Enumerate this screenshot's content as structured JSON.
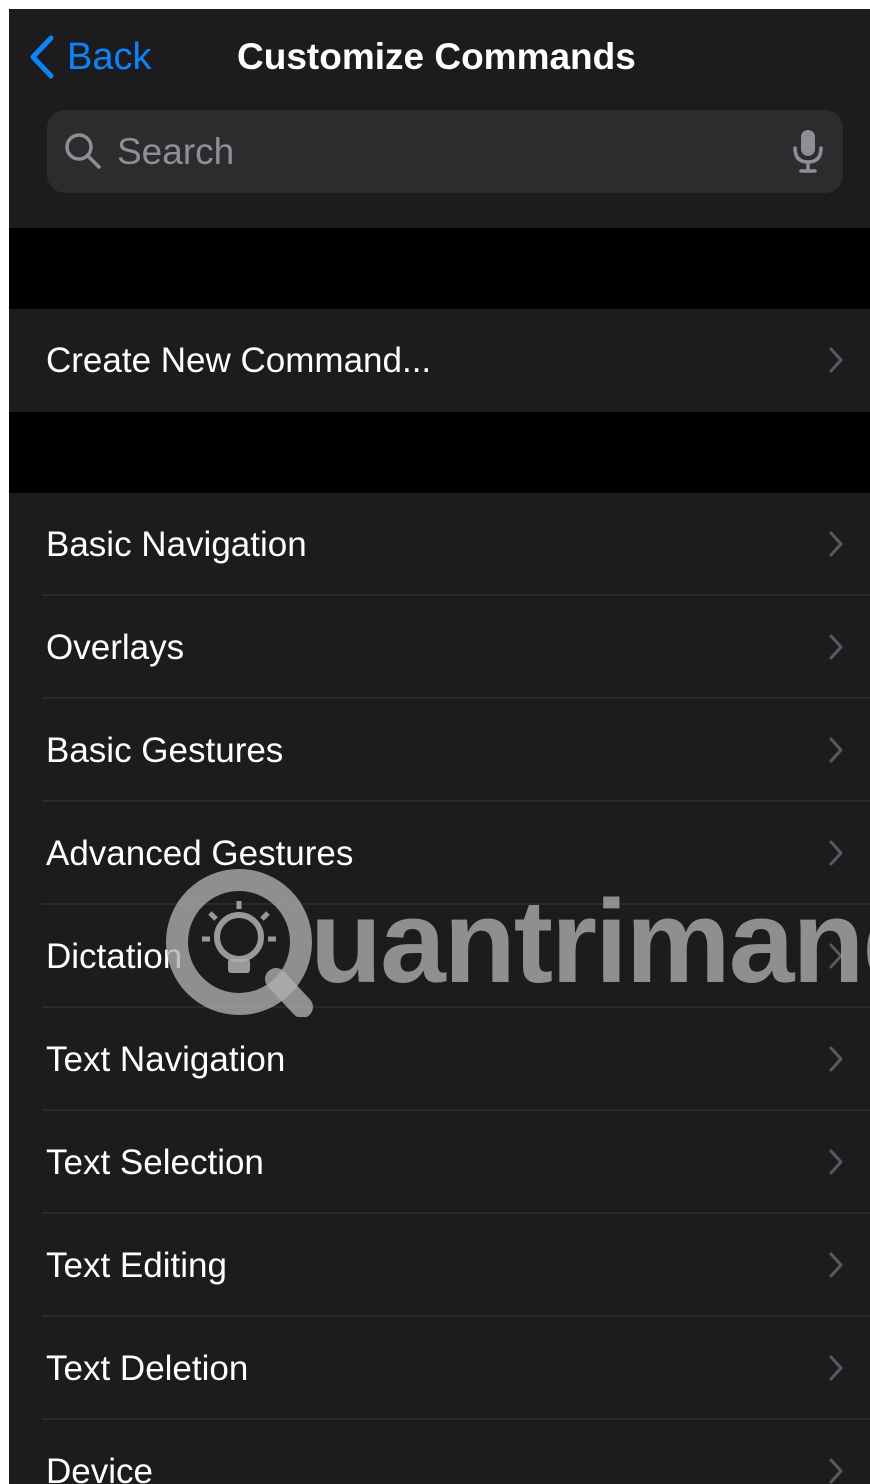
{
  "nav": {
    "back_label": "Back",
    "title": "Customize Commands"
  },
  "search": {
    "placeholder": "Search"
  },
  "sections": {
    "create": {
      "label": "Create New Command..."
    },
    "commands": [
      {
        "label": "Basic Navigation"
      },
      {
        "label": "Overlays"
      },
      {
        "label": "Basic Gestures"
      },
      {
        "label": "Advanced Gestures"
      },
      {
        "label": "Dictation"
      },
      {
        "label": "Text Navigation"
      },
      {
        "label": "Text Selection"
      },
      {
        "label": "Text Editing"
      },
      {
        "label": "Text Deletion"
      },
      {
        "label": "Device"
      }
    ]
  },
  "watermark": {
    "text": "uantrimang"
  },
  "icons": {
    "back": "chevron-left-icon",
    "search": "search-icon",
    "microphone": "microphone-icon",
    "row_disclosure": "chevron-right-icon"
  },
  "colors": {
    "accent": "#0a84ff",
    "background": "#000000",
    "cell": "#1c1c1e",
    "search_field": "#2c2c2e",
    "secondary_text": "#8e8e93",
    "separator": "#2a2a2c"
  }
}
